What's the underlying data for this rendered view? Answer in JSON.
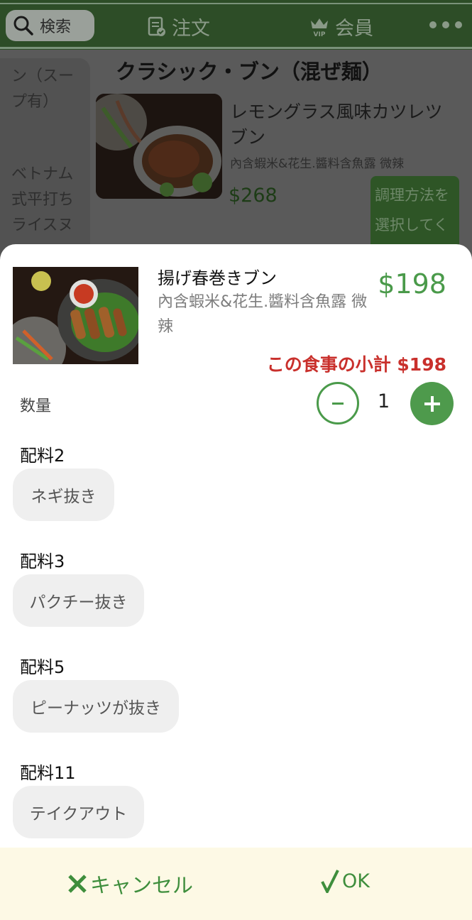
{
  "header": {
    "search_label": "検索",
    "tabs": [
      {
        "label": "注文",
        "icon": "order-document-icon"
      },
      {
        "label": "会員",
        "icon": "vip-crown-icon"
      }
    ],
    "more_icon": "more-dots-icon"
  },
  "background": {
    "sidebar_items": [
      "ン（スープ有）",
      "ベトナム式平打ちライスヌ"
    ],
    "section_title": "クラシック・ブン（混ぜ麺）",
    "item": {
      "name": "レモングラス風味カツレツブン",
      "description": "內含蝦米&花生.醬料含魚露 微辣",
      "price": "$268",
      "button_label": "調理方法を選択してく"
    }
  },
  "sheet": {
    "product": {
      "name": "揚げ春巻きブン",
      "description": "內含蝦米&花生.醬料含魚露 微辣",
      "price": "$198"
    },
    "subtotal": "この食事の小計 $198",
    "quantity": {
      "label": "数量",
      "value": "1"
    },
    "options": [
      {
        "label": "配料2",
        "chip": "ネギ抜き"
      },
      {
        "label": "配料3",
        "chip": "パクチー抜き"
      },
      {
        "label": "配料5",
        "chip": "ピーナッツが抜き"
      },
      {
        "label": "配料11",
        "chip": "テイクアウト"
      }
    ],
    "footer": {
      "cancel_label": "キャンセル",
      "ok_label": "OK"
    }
  },
  "colors": {
    "accent_green": "#4a9a4a",
    "subtotal_red": "#c9302c",
    "header_green": "#2d4d27",
    "footer_bg": "#fdf9e5"
  }
}
